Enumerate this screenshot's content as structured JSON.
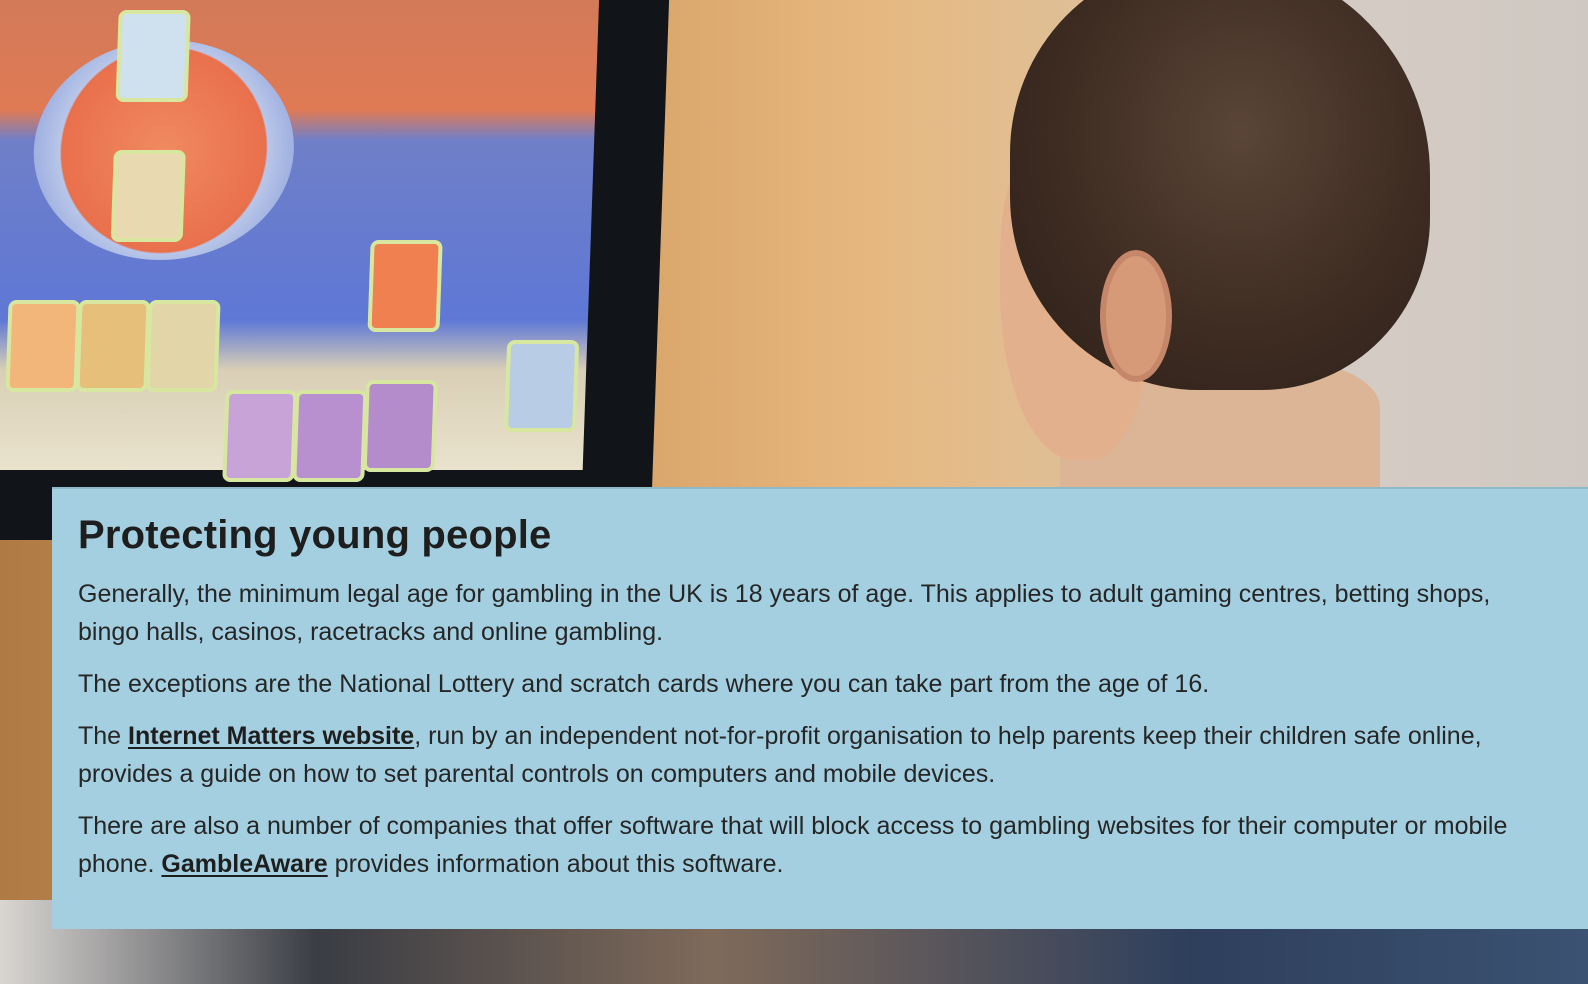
{
  "section": {
    "title": "Protecting young people",
    "paragraph1": "Generally, the minimum legal age for gambling in the UK is 18 years of age. This applies to adult gaming centres, betting shops, bingo halls, casinos, racetracks and online gambling.",
    "paragraph2": "The exceptions are the National Lottery and scratch cards where you can take part from the age of 16.",
    "paragraph3": {
      "prefix": "The ",
      "link_label": "Internet Matters website",
      "suffix": ", run by an independent not-for-profit organisation to help parents keep their children safe online, provides a guide on how to set parental controls on computers and mobile devices."
    },
    "paragraph4": {
      "prefix": "There are also a number of companies that offer software that will block access to gambling websites for their computer or mobile phone. ",
      "link_label": "GambleAware",
      "suffix": " provides information about this software."
    }
  },
  "colors": {
    "panel_background": "#a3cfe0",
    "text": "#1f1f1f"
  }
}
